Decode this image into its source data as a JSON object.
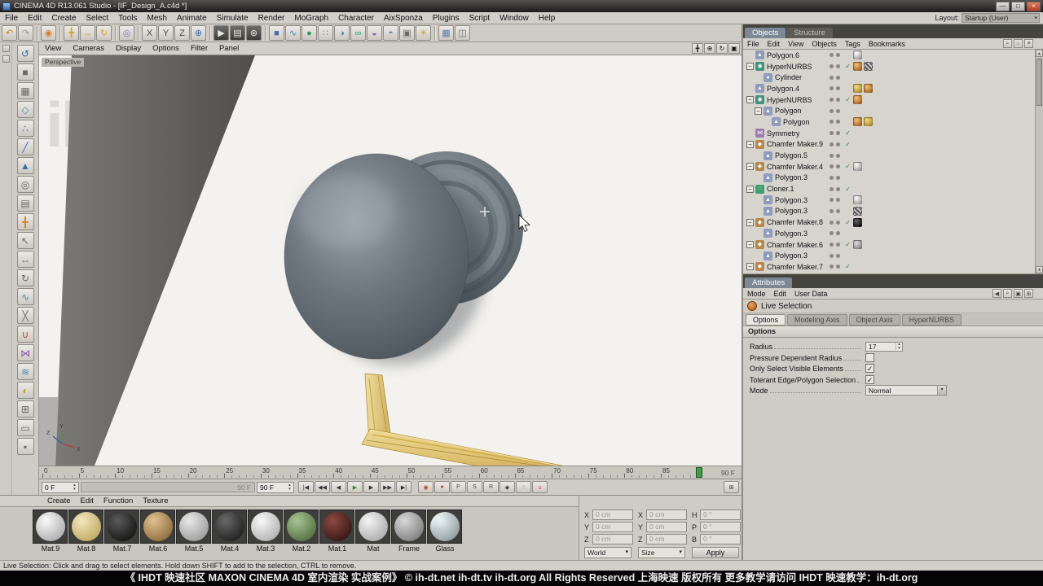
{
  "window": {
    "title": "CINEMA 4D R13.061 Studio - [IF_Design_A.c4d *]",
    "layout_label": "Layout:",
    "layout_value": "Startup (User)",
    "buttons": [
      {
        "name": "minimize-button",
        "glyph": "—"
      },
      {
        "name": "maximize-button",
        "glyph": "□"
      },
      {
        "name": "close-button",
        "glyph": "×"
      }
    ]
  },
  "menubar": [
    "File",
    "Edit",
    "Create",
    "Select",
    "Tools",
    "Mesh",
    "Animate",
    "Simulate",
    "Render",
    "MoGraph",
    "Character",
    "AixSponza",
    "Plugins",
    "Script",
    "Window",
    "Help"
  ],
  "toolbar": [
    {
      "name": "undo",
      "glyph": "↶",
      "color": "#c78a1e"
    },
    {
      "name": "redo",
      "glyph": "↷",
      "color": "#9a9890"
    },
    {
      "name": "sep"
    },
    {
      "name": "live-selection",
      "glyph": "◉",
      "color": "#e07b20"
    },
    {
      "name": "sep"
    },
    {
      "name": "move-tool",
      "glyph": "╋",
      "color": "#d9a51f"
    },
    {
      "name": "scale-tool",
      "glyph": "↔",
      "color": "#d9a51f"
    },
    {
      "name": "rotate-tool",
      "glyph": "↻",
      "color": "#d9a51f"
    },
    {
      "name": "sep"
    },
    {
      "name": "last-tool",
      "glyph": "◎",
      "color": "#7d7db5"
    },
    {
      "name": "sep"
    },
    {
      "name": "lock-x-axis",
      "glyph": "X",
      "color": "#4a4a46"
    },
    {
      "name": "lock-y-axis",
      "glyph": "Y",
      "color": "#4a4a46"
    },
    {
      "name": "lock-z-axis",
      "glyph": "Z",
      "color": "#4a4a46"
    },
    {
      "name": "coordinate-system",
      "glyph": "⊕",
      "color": "#3a6fae"
    },
    {
      "name": "sep"
    },
    {
      "name": "render-view",
      "glyph": "▶",
      "color": "#e8e6e0",
      "dark": true
    },
    {
      "name": "render-picture-viewer",
      "glyph": "▤",
      "color": "#e8e6e0",
      "dark": true
    },
    {
      "name": "render-settings",
      "glyph": "⊛",
      "color": "#e8e6e0",
      "dark": true
    },
    {
      "name": "sep"
    },
    {
      "name": "add-primitive",
      "glyph": "■",
      "color": "#4a6cb8"
    },
    {
      "name": "add-spline",
      "glyph": "∿",
      "color": "#3a8ab8"
    },
    {
      "name": "add-hypernurbs",
      "glyph": "●",
      "color": "#2f9a58"
    },
    {
      "name": "add-array",
      "glyph": "∷",
      "color": "#2f9a8a"
    },
    {
      "name": "add-boole",
      "glyph": "◑",
      "color": "#3a84b0"
    },
    {
      "name": "add-mograph",
      "glyph": "∞",
      "color": "#28a878"
    },
    {
      "name": "add-deformer",
      "glyph": "◒",
      "color": "#8a5ab0"
    },
    {
      "name": "add-environment",
      "glyph": "◓",
      "color": "#5a8ab0"
    },
    {
      "name": "add-camera",
      "glyph": "▣",
      "color": "#6a6a64"
    },
    {
      "name": "add-light",
      "glyph": "☀",
      "color": "#c8a820"
    },
    {
      "name": "sep"
    },
    {
      "name": "snap-settings",
      "glyph": "▦",
      "color": "#5a7ab0"
    },
    {
      "name": "viewport-layout",
      "glyph": "◫",
      "color": "#6a6a64"
    }
  ],
  "left_palette": [
    {
      "name": "make-editable",
      "glyph": "↺",
      "color": "#3a6fae"
    },
    {
      "name": "model-mode",
      "glyph": "■",
      "color": "#6a6a64"
    },
    {
      "name": "texture-mode",
      "glyph": "▦",
      "color": "#6a6a64"
    },
    {
      "name": "workplane-mode",
      "glyph": "◇",
      "color": "#3a8ab0"
    },
    {
      "name": "points-mode",
      "glyph": "∴",
      "color": "#3a6fae"
    },
    {
      "name": "edges-mode",
      "glyph": "╱",
      "color": "#3a6fae"
    },
    {
      "name": "polygons-mode",
      "glyph": "▲",
      "color": "#3a6fae"
    },
    {
      "name": "animation-mode",
      "glyph": "◎",
      "color": "#6a6a64"
    },
    {
      "name": "texture-axis-mode",
      "glyph": "▤",
      "color": "#6a6a64"
    },
    {
      "name": "object-axis-mode",
      "glyph": "╋",
      "color": "#d9821f"
    },
    {
      "name": "normal-move",
      "glyph": "↖",
      "color": "#6a6a64"
    },
    {
      "name": "normal-scale",
      "glyph": "↔",
      "color": "#6a6a64"
    },
    {
      "name": "normal-rotate",
      "glyph": "↻",
      "color": "#6a6a64"
    },
    {
      "name": "brush-tool",
      "glyph": "∿",
      "color": "#3a8ab0"
    },
    {
      "name": "knife-tool",
      "glyph": "╳",
      "color": "#6a6a64"
    },
    {
      "name": "magnet-tool",
      "glyph": "∪",
      "color": "#b04a3a"
    },
    {
      "name": "mirror-tool",
      "glyph": "⋈",
      "color": "#8a5ab0"
    },
    {
      "name": "smooth-tool",
      "glyph": "≋",
      "color": "#3a8ab0"
    },
    {
      "name": "snap-enable",
      "glyph": "◐",
      "color": "#c8a11e"
    },
    {
      "name": "quantize",
      "glyph": "⊞",
      "color": "#6a6a64"
    },
    {
      "name": "workplane-lock",
      "glyph": "▭",
      "color": "#6a6a64"
    },
    {
      "name": "viewport-solo",
      "glyph": "▪",
      "color": "#6a6a64"
    }
  ],
  "viewport": {
    "menu": [
      "View",
      "Cameras",
      "Display",
      "Options",
      "Filter",
      "Panel"
    ],
    "label": "Perspective",
    "watermark": "ihdt",
    "nav_icons": [
      "move-camera-icon",
      "zoom-camera-icon",
      "rotate-camera-icon",
      "maximize-view-icon"
    ],
    "axis_labels": {
      "x": "X",
      "y": "Y",
      "z": "Z"
    }
  },
  "timeline": {
    "tick_labels": [
      "0",
      "5",
      "10",
      "15",
      "20",
      "25",
      "30",
      "35",
      "40",
      "45",
      "50",
      "55",
      "60",
      "65",
      "70",
      "75",
      "80",
      "85"
    ],
    "range_end_label": "90 F",
    "current_frame": "0 F",
    "end_frame": "90 F",
    "marker_color": "#3f9e43"
  },
  "transport": {
    "buttons": [
      {
        "name": "goto-start",
        "glyph": "|◀"
      },
      {
        "name": "prev-key",
        "glyph": "◀◀"
      },
      {
        "name": "prev-frame",
        "glyph": "◀"
      },
      {
        "name": "play",
        "glyph": "▶",
        "color": "#2f8a34"
      },
      {
        "name": "next-frame",
        "glyph": "▶"
      },
      {
        "name": "next-key",
        "glyph": "▶▶"
      },
      {
        "name": "goto-end",
        "glyph": "▶|"
      }
    ],
    "record_buttons": [
      {
        "name": "record-keyframe",
        "glyph": "◉",
        "color": "#c23a2a"
      },
      {
        "name": "autokey",
        "glyph": "●",
        "color": "#c23a2a"
      },
      {
        "name": "record-position",
        "glyph": "P",
        "color": "#4a4a46"
      },
      {
        "name": "record-scale",
        "glyph": "S",
        "color": "#4a4a46"
      },
      {
        "name": "record-rotation",
        "glyph": "R",
        "color": "#4a4a46"
      },
      {
        "name": "record-parameter",
        "glyph": "◆",
        "color": "#4a4a46"
      },
      {
        "name": "record-point-level",
        "glyph": "∴",
        "color": "#4a4a46"
      },
      {
        "name": "snap-magnet",
        "glyph": "∪",
        "color": "#b04a3a"
      }
    ],
    "options_button_glyph": "⊞"
  },
  "object_manager": {
    "tabs": [
      {
        "label": "Objects",
        "active": true
      },
      {
        "label": "Structure",
        "active": false
      }
    ],
    "menu": [
      "File",
      "Edit",
      "View",
      "Objects",
      "Tags",
      "Bookmarks"
    ],
    "items": [
      {
        "name": "Polygon.6",
        "indent": 0,
        "icon": "polygon",
        "tags": [
          "white"
        ]
      },
      {
        "name": "HyperNURBS",
        "indent": 0,
        "expander": "minus",
        "icon": "hypernurbs",
        "check": true,
        "tags": [
          "orange",
          "checker"
        ]
      },
      {
        "name": "Cylinder",
        "indent": 1,
        "icon": "cylinder",
        "tags": []
      },
      {
        "name": "Polygon.4",
        "indent": 0,
        "icon": "polygon",
        "tags": [
          "yellow",
          "orange"
        ]
      },
      {
        "name": "HyperNURBS",
        "indent": 0,
        "expander": "minus",
        "icon": "hypernurbs",
        "check": true,
        "tags": [
          "orange"
        ]
      },
      {
        "name": "Polygon",
        "indent": 1,
        "expander": "minus",
        "icon": "polygon",
        "tags": []
      },
      {
        "name": "Polygon",
        "indent": 2,
        "icon": "polygon",
        "tags": [
          "orange",
          "yellow"
        ]
      },
      {
        "name": "Symmetry",
        "indent": 0,
        "icon": "symmetry",
        "check": true,
        "tags": []
      },
      {
        "name": "Chamfer Maker.9",
        "indent": 0,
        "expander": "minus",
        "icon": "chamfer",
        "check": true,
        "tags": []
      },
      {
        "name": "Polygon.5",
        "indent": 1,
        "icon": "polygon",
        "tags": []
      },
      {
        "name": "Chamfer Maker.4",
        "indent": 0,
        "expander": "minus",
        "icon": "chamfer",
        "check": true,
        "tags": [
          "white"
        ]
      },
      {
        "name": "Polygon.3",
        "indent": 1,
        "icon": "polygon",
        "tags": []
      },
      {
        "name": "Cloner.1",
        "indent": 0,
        "expander": "minus",
        "icon": "cloner",
        "check": true,
        "tags": []
      },
      {
        "name": "Polygon.3",
        "indent": 1,
        "icon": "polygon",
        "tags": [
          "white"
        ]
      },
      {
        "name": "Polygon.3",
        "indent": 1,
        "icon": "polygon",
        "tags": [
          "checker"
        ]
      },
      {
        "name": "Chamfer Maker.8",
        "indent": 0,
        "expander": "minus",
        "icon": "chamfer",
        "check": true,
        "tags": [
          "dark"
        ]
      },
      {
        "name": "Polygon.3",
        "indent": 1,
        "icon": "polygon",
        "tags": []
      },
      {
        "name": "Chamfer Maker.6",
        "indent": 0,
        "expander": "minus",
        "icon": "chamfer",
        "check": true,
        "tags": [
          "gray"
        ]
      },
      {
        "name": "Polygon.3",
        "indent": 1,
        "icon": "polygon",
        "tags": []
      },
      {
        "name": "Chamfer Maker.7",
        "indent": 0,
        "expander": "minus",
        "icon": "chamfer",
        "check": true,
        "tags": []
      }
    ]
  },
  "attributes": {
    "tab": "Attributes",
    "menu": [
      "Mode",
      "Edit",
      "User Data"
    ],
    "tool_title": "Live Selection",
    "tabs": [
      {
        "label": "Options",
        "active": true
      },
      {
        "label": "Modeling Axis",
        "active": false
      },
      {
        "label": "Object Axis",
        "active": false
      },
      {
        "label": "HyperNURBS",
        "active": false
      }
    ],
    "section": "Options",
    "fields": [
      {
        "label": "Radius",
        "type": "spinner",
        "value": "17"
      },
      {
        "label": "Pressure Dependent Radius",
        "type": "checkbox",
        "checked": false
      },
      {
        "label": "Only Select Visible Elements",
        "type": "checkbox",
        "checked": true
      },
      {
        "label": "Tolerant Edge/Polygon Selection",
        "type": "checkbox",
        "checked": true
      },
      {
        "label": "Mode",
        "type": "dropdown",
        "value": "Normal"
      }
    ]
  },
  "materials": {
    "menu": [
      "Create",
      "Edit",
      "Function",
      "Texture"
    ],
    "items": [
      {
        "name": "Mat.9",
        "hi": "#fafafa",
        "lo": "#9a9a9a"
      },
      {
        "name": "Mat.8",
        "hi": "#f2e7bd",
        "lo": "#b39a4e"
      },
      {
        "name": "Mat.7",
        "hi": "#5a5a5a",
        "lo": "#050505"
      },
      {
        "name": "Mat.6",
        "hi": "#e0c08e",
        "lo": "#7a5a28"
      },
      {
        "name": "Mat.5",
        "hi": "#e8e8e8",
        "lo": "#8a8a8a"
      },
      {
        "name": "Mat.4",
        "hi": "#686868",
        "lo": "#101010"
      },
      {
        "name": "Mat.3",
        "hi": "#f8f8f8",
        "lo": "#a0a0a0"
      },
      {
        "name": "Mat.2",
        "hi": "#a8c493",
        "lo": "#3f5c2e"
      },
      {
        "name": "Mat.1",
        "hi": "#8a4a42",
        "lo": "#230a08"
      },
      {
        "name": "Mat",
        "hi": "#f4f4f4",
        "lo": "#9a9a9a"
      },
      {
        "name": "Frame",
        "hi": "#d8d8d8",
        "lo": "#6a6a6a"
      },
      {
        "name": "Glass",
        "hi": "#e8f0f2",
        "lo": "#7a8a90",
        "glass": true
      }
    ]
  },
  "coordinates": {
    "position": {
      "labels": [
        "X",
        "Y",
        "Z"
      ],
      "values": [
        "0 cm",
        "0 cm",
        "0 cm"
      ]
    },
    "size": {
      "labels": [
        "X",
        "Y",
        "Z"
      ],
      "values": [
        "0 cm",
        "0 cm",
        "0 cm"
      ]
    },
    "rotation": {
      "labels": [
        "H",
        "P",
        "B"
      ],
      "values": [
        "0 °",
        "0 °",
        "0 °"
      ]
    },
    "space_dropdown": "World",
    "size_dropdown": "Size",
    "apply_label": "Apply"
  },
  "status": "Live Selection: Click and drag to select elements. Hold down SHIFT to add to the selection, CTRL to remove.",
  "banner": "《 IHDT 映速社区 MAXON CINEMA 4D 室内渲染 实战案例》  ©  ih-dt.net  ih-dt.tv  ih-dt.org   All Rights Reserved  上海映速 版权所有     更多教学请访问 IHDT 映速教学：ih-dt.org"
}
